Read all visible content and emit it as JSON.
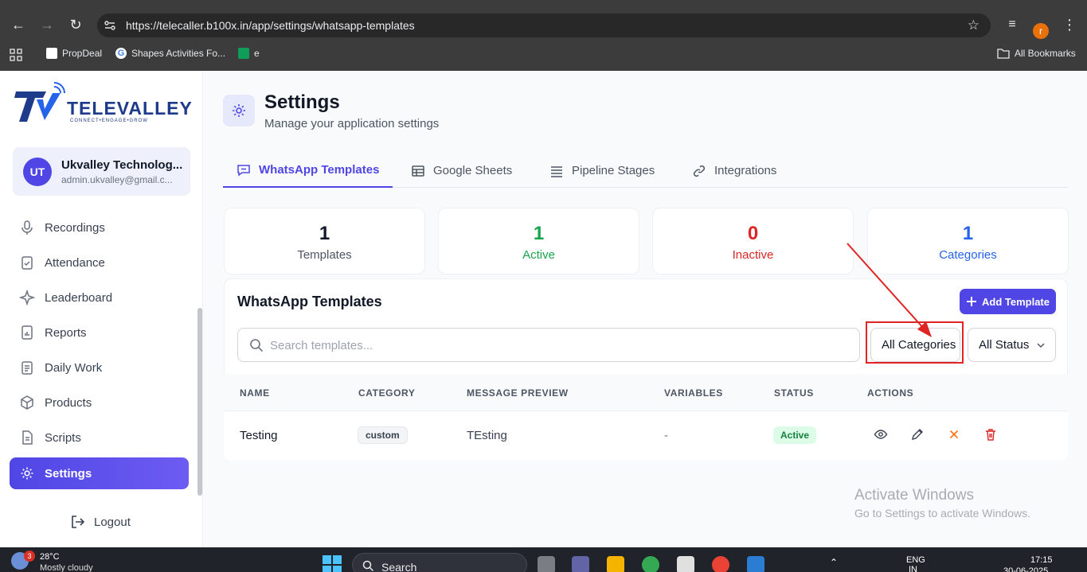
{
  "browser": {
    "url": "https://telecaller.b100x.in/app/settings/whatsapp-templates",
    "profile_initial": "r",
    "bookmarks": [
      "PropDeal",
      "Shapes Activities Fo...",
      "e"
    ],
    "all_bookmarks": "All Bookmarks"
  },
  "sidebar": {
    "logo_text": "TELEVALLEY",
    "logo_tagline": "CONNECT•ENGAGE•GROW",
    "user": {
      "initials": "UT",
      "name": "Ukvalley Technolog...",
      "email": "admin.ukvalley@gmail.c..."
    },
    "items": [
      {
        "label": "Recordings",
        "icon": "mic-icon"
      },
      {
        "label": "Attendance",
        "icon": "clipboard-check-icon"
      },
      {
        "label": "Leaderboard",
        "icon": "sparkle-icon"
      },
      {
        "label": "Reports",
        "icon": "report-chart-icon"
      },
      {
        "label": "Daily Work",
        "icon": "clipboard-list-icon"
      },
      {
        "label": "Products",
        "icon": "box-icon"
      },
      {
        "label": "Scripts",
        "icon": "file-text-icon"
      },
      {
        "label": "Settings",
        "icon": "gear-icon",
        "active": true
      }
    ],
    "logout": "Logout"
  },
  "page": {
    "title": "Settings",
    "subtitle": "Manage your application settings"
  },
  "tabs": [
    {
      "label": "WhatsApp Templates",
      "active": true
    },
    {
      "label": "Google Sheets"
    },
    {
      "label": "Pipeline Stages"
    },
    {
      "label": "Integrations"
    }
  ],
  "stats": [
    {
      "value": "1",
      "label": "Templates",
      "color": "#111827",
      "label_color": "#4b5563"
    },
    {
      "value": "1",
      "label": "Active",
      "color": "#16a34a",
      "label_color": "#16a34a"
    },
    {
      "value": "0",
      "label": "Inactive",
      "color": "#dc2626",
      "label_color": "#dc2626"
    },
    {
      "value": "1",
      "label": "Categories",
      "color": "#2563eb",
      "label_color": "#2563eb"
    }
  ],
  "templates_panel": {
    "title": "WhatsApp Templates",
    "add_button": "Add Template",
    "search_placeholder": "Search templates...",
    "category_filter": "All Categories",
    "status_filter": "All Status"
  },
  "table": {
    "columns": [
      "NAME",
      "CATEGORY",
      "MESSAGE PREVIEW",
      "VARIABLES",
      "STATUS",
      "ACTIONS"
    ],
    "rows": [
      {
        "name": "Testing",
        "category": "custom",
        "preview": "TEsting",
        "variables": "-",
        "status": "Active"
      }
    ]
  },
  "watermark": {
    "line1": "Activate Windows",
    "line2": "Go to Settings to activate Windows."
  },
  "taskbar": {
    "weather_badge": "3",
    "temperature": "28°C",
    "weather_desc": "Mostly cloudy",
    "search": "Search",
    "language": "ENG",
    "region": "IN",
    "time": "17:15",
    "date": "30-06-2025"
  },
  "colors": {
    "accent": "#4f46e5",
    "annotation": "#e02424"
  }
}
